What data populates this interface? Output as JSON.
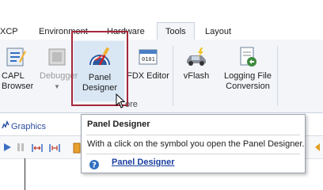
{
  "tabs": [
    {
      "label": "XCP"
    },
    {
      "label": "Environment"
    },
    {
      "label": "Hardware"
    },
    {
      "label": "Tools",
      "active": true
    },
    {
      "label": "Layout"
    }
  ],
  "ribbon": {
    "buttons": [
      {
        "label": "CAPL\nBrowser"
      },
      {
        "label": "Debugger"
      },
      {
        "label": "Panel\nDesigner"
      },
      {
        "label": "FDX Editor"
      },
      {
        "label": "vFlash"
      },
      {
        "label": "Logging File\nConversion"
      }
    ],
    "group_label": "ore"
  },
  "strip": {
    "title": "Graphics"
  },
  "tooltip": {
    "title": "Panel Designer",
    "description": "With a click on the symbol you open the Panel Designer.",
    "link": "Panel Designer"
  },
  "colors": {
    "highlight": "#a5273a",
    "link": "#1b3fa0",
    "hover": "#d9e6f4"
  }
}
